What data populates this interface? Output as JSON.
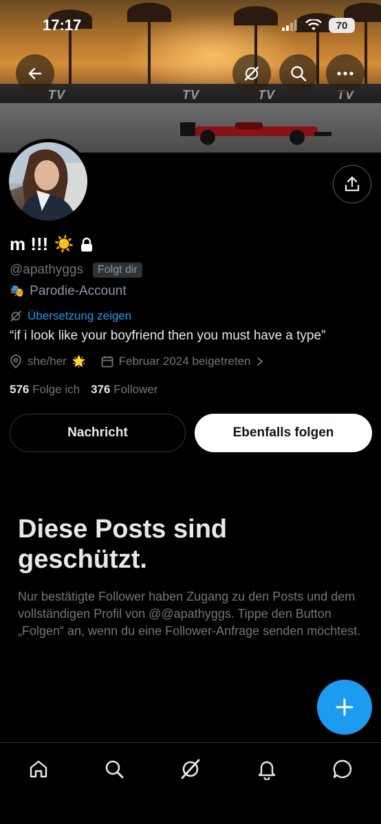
{
  "status_bar": {
    "time": "17:17",
    "battery": "70"
  },
  "profile": {
    "display_name": "m !!!",
    "name_emoji": "☀️",
    "handle": "@apathyggs",
    "follows_you_badge": "Folgt dir",
    "parody_emoji": "🎭",
    "parody_label": "Parodie-Account",
    "translate_label": "Übersetzung zeigen",
    "bio": "“if i look like your boyfriend then you must have a type”",
    "pronouns": "she/her",
    "pronouns_emoji": "🌟",
    "joined": "Februar 2024 beigetreten",
    "following_count": "576",
    "following_label": "Folge ich",
    "followers_count": "376",
    "followers_label": "Follower"
  },
  "actions": {
    "message_label": "Nachricht",
    "follow_label": "Ebenfalls folgen"
  },
  "protected": {
    "title": "Diese Posts sind geschützt.",
    "text": "Nur bestätigte Follower haben Zugang zu den Posts und dem vollständigen Profil von @@apathyggs. Tippe den Button „Folgen“ an, wenn du eine Follower-Anfrage senden möchtest."
  },
  "banner_text": {
    "tv": "TV"
  },
  "colors": {
    "accent": "#1d9bf0",
    "background": "#000000",
    "muted": "#71767b"
  },
  "icons": [
    "back-arrow-icon",
    "grok-icon",
    "search-icon",
    "more-icon",
    "share-icon",
    "lock-icon",
    "location-icon",
    "calendar-icon",
    "chevron-right-icon",
    "plus-icon",
    "home-icon",
    "bell-icon",
    "messages-icon"
  ]
}
